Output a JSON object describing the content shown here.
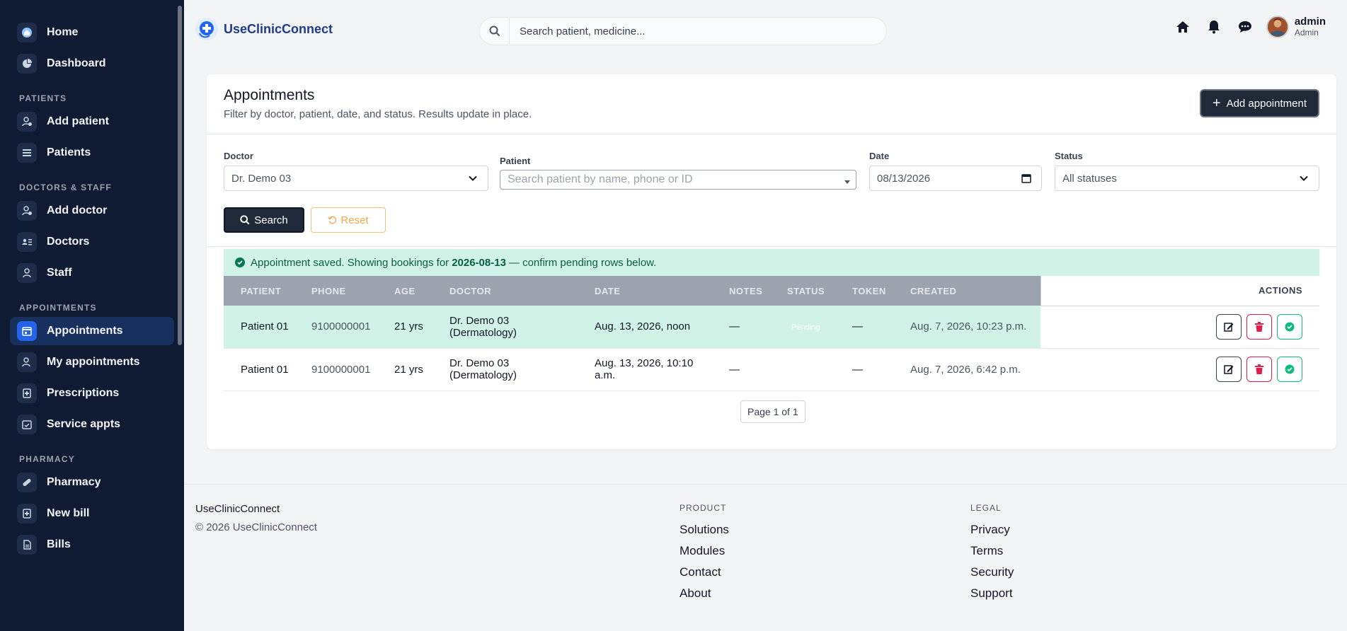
{
  "sidebar": {
    "items_top": [
      {
        "label": "Home",
        "icon": "home-icon"
      },
      {
        "label": "Dashboard",
        "icon": "pie-chart-icon"
      }
    ],
    "sections": [
      {
        "title": "PATIENTS",
        "items": [
          {
            "label": "Add patient",
            "icon": "add-user-icon"
          },
          {
            "label": "Patients",
            "icon": "list-icon"
          }
        ]
      },
      {
        "title": "DOCTORS & STAFF",
        "items": [
          {
            "label": "Add doctor",
            "icon": "add-user-icon"
          },
          {
            "label": "Doctors",
            "icon": "id-card-icon"
          },
          {
            "label": "Staff",
            "icon": "user-icon"
          }
        ]
      },
      {
        "title": "APPOINTMENTS",
        "items": [
          {
            "label": "Appointments",
            "icon": "calendar-icon",
            "active": true
          },
          {
            "label": "My appointments",
            "icon": "user-icon"
          },
          {
            "label": "Prescriptions",
            "icon": "prescription-icon"
          },
          {
            "label": "Service appts",
            "icon": "calendar-check-icon"
          }
        ]
      },
      {
        "title": "PHARMACY",
        "items": [
          {
            "label": "Pharmacy",
            "icon": "pill-icon"
          },
          {
            "label": "New bill",
            "icon": "bill-icon"
          },
          {
            "label": "Bills",
            "icon": "document-icon"
          }
        ]
      }
    ]
  },
  "header": {
    "brand": "UseClinicConnect",
    "search_placeholder": "Search patient, medicine...",
    "user_name": "admin",
    "user_role": "Admin"
  },
  "page": {
    "title": "Appointments",
    "subtitle": "Filter by doctor, patient, date, and status. Results update in place.",
    "add_button": "Add appointment"
  },
  "filters": {
    "doctor_label": "Doctor",
    "doctor_value": "Dr. Demo 03",
    "patient_label": "Patient",
    "patient_placeholder": "Search patient by name, phone or ID",
    "date_label": "Date",
    "date_value": "08/13/2026",
    "status_label": "Status",
    "status_value": "All statuses",
    "search_button": "Search",
    "reset_button": "Reset"
  },
  "alert": {
    "prefix": "Appointment saved. Showing bookings for",
    "date": "2026-08-13",
    "suffix": "— confirm pending rows below."
  },
  "table": {
    "columns": [
      "PATIENT",
      "PHONE",
      "AGE",
      "DOCTOR",
      "DATE",
      "NOTES",
      "STATUS",
      "TOKEN",
      "CREATED",
      "ACTIONS"
    ],
    "rows": [
      {
        "patient": "Patient 01",
        "phone": "9100000001",
        "age": "21 yrs",
        "doctor": "Dr. Demo 03 (Dermatology)",
        "date": "Aug. 13, 2026, noon",
        "notes": "—",
        "status": "Pending",
        "token": "—",
        "created": "Aug. 7, 2026, 10:23 p.m.",
        "highlight": true
      },
      {
        "patient": "Patient 01",
        "phone": "9100000001",
        "age": "21 yrs",
        "doctor": "Dr. Demo 03 (Dermatology)",
        "date": "Aug. 13, 2026, 10:10 a.m.",
        "notes": "—",
        "status": "",
        "token": "—",
        "created": "Aug. 7, 2026, 6:42 p.m.",
        "highlight": false
      }
    ]
  },
  "pagination": {
    "label": "Page 1 of 1"
  },
  "footer": {
    "brand": "UseClinicConnect",
    "copyright": "© 2026 UseClinicConnect",
    "product_title": "PRODUCT",
    "product_links": [
      "Solutions",
      "Modules",
      "Contact",
      "About"
    ],
    "legal_title": "LEGAL",
    "legal_links": [
      "Privacy",
      "Terms",
      "Security",
      "Support"
    ]
  },
  "colors": {
    "sidebar_bg": "#0f1b33",
    "accent": "#2563eb",
    "success_bg": "#d1f2e6",
    "danger": "#e11d48"
  }
}
